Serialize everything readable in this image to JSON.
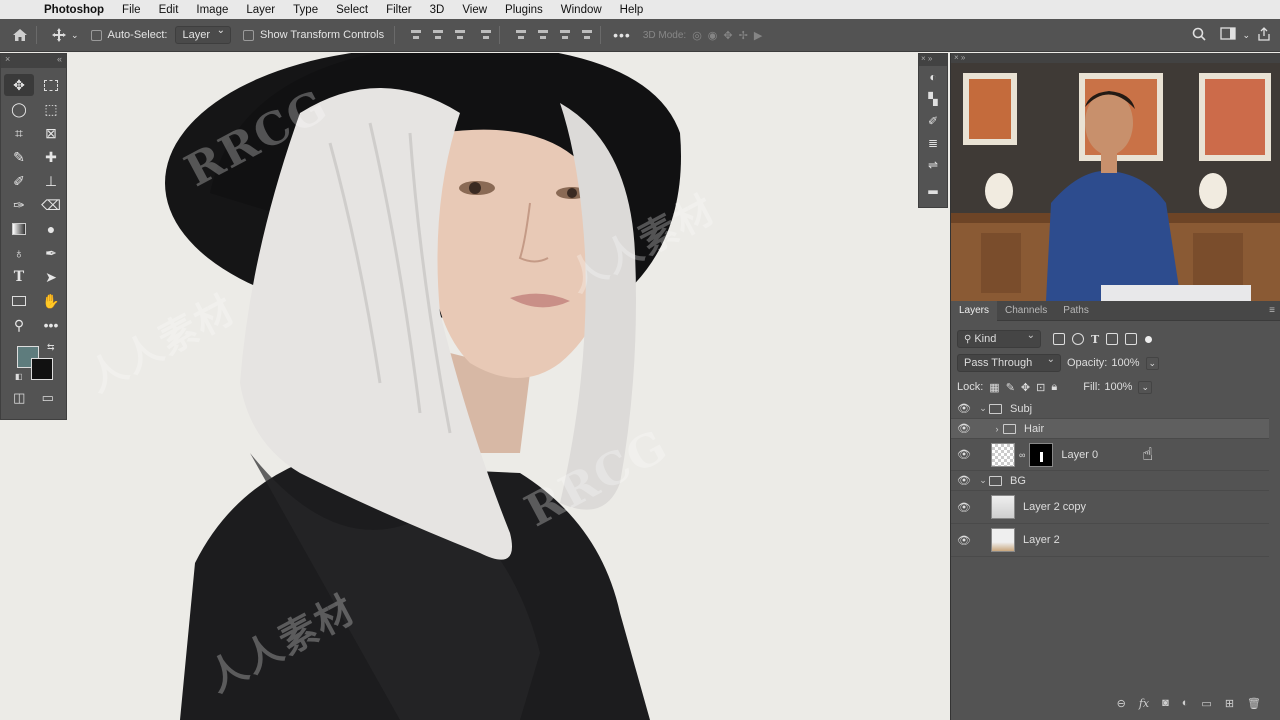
{
  "menubar": {
    "app": "Photoshop",
    "items": [
      "File",
      "Edit",
      "Image",
      "Layer",
      "Type",
      "Select",
      "Filter",
      "3D",
      "View",
      "Plugins",
      "Window",
      "Help"
    ]
  },
  "options": {
    "auto_select_label": "Auto-Select:",
    "auto_select_value": "Layer",
    "transform_label": "Show Transform Controls",
    "mode_3d": "3D Mode:"
  },
  "tools": {
    "names": [
      "move-tool",
      "marquee-tool",
      "lasso-tool",
      "object-select-tool",
      "crop-tool",
      "frame-tool",
      "eyedropper-tool",
      "healing-tool",
      "brush-tool",
      "stamp-tool",
      "history-brush-tool",
      "eraser-tool",
      "gradient-tool",
      "blur-tool",
      "dodge-tool",
      "pen-tool",
      "type-tool",
      "path-select-tool",
      "rectangle-tool",
      "hand-tool",
      "zoom-tool",
      "more-tools"
    ],
    "foreground": "#5e7c7d",
    "background": "#111111"
  },
  "layers_panel": {
    "tabs": [
      "Layers",
      "Channels",
      "Paths"
    ],
    "filter_kind": "Kind",
    "blend_mode": "Pass Through",
    "opacity_label": "Opacity:",
    "opacity_value": "100%",
    "lock_label": "Lock:",
    "fill_label": "Fill:",
    "fill_value": "100%",
    "layers": [
      {
        "name": "Subj",
        "type": "group",
        "expanded": true
      },
      {
        "name": "Hair",
        "type": "group",
        "expanded": false
      },
      {
        "name": "Layer 0",
        "type": "layer",
        "masked": true
      },
      {
        "name": "BG",
        "type": "group",
        "expanded": true
      },
      {
        "name": "Layer 2 copy",
        "type": "layer"
      },
      {
        "name": "Layer 2",
        "type": "layer"
      }
    ]
  },
  "watermark": {
    "text_latin": "RRCG",
    "text_cjk": "人人素材"
  }
}
